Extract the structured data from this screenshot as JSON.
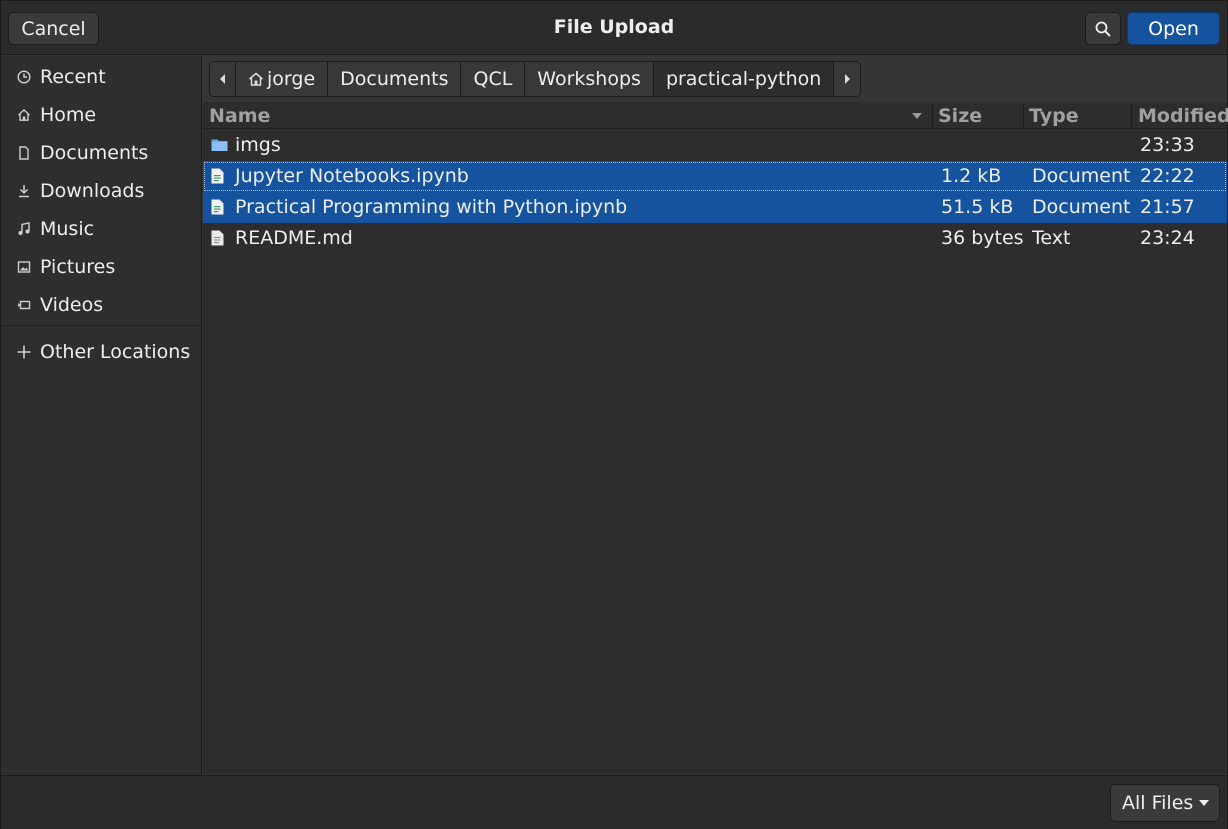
{
  "header": {
    "cancel_label": "Cancel",
    "title": "File Upload",
    "search_icon": "search-icon",
    "open_label": "Open"
  },
  "sidebar": {
    "items": [
      {
        "label": "Recent",
        "icon": "clock-icon"
      },
      {
        "label": "Home",
        "icon": "home-icon"
      },
      {
        "label": "Documents",
        "icon": "document-icon"
      },
      {
        "label": "Downloads",
        "icon": "download-icon"
      },
      {
        "label": "Music",
        "icon": "music-icon"
      },
      {
        "label": "Pictures",
        "icon": "picture-icon"
      },
      {
        "label": "Videos",
        "icon": "video-icon"
      }
    ],
    "other_locations": {
      "label": "Other Locations",
      "icon": "plus-icon"
    }
  },
  "pathbar": {
    "segments": [
      "jorge",
      "Documents",
      "QCL",
      "Workshops",
      "practical-python"
    ],
    "current": "practical-python"
  },
  "columns": {
    "name": "Name",
    "size": "Size",
    "type": "Type",
    "modified": "Modified",
    "sort": "descending"
  },
  "files": [
    {
      "name": "imgs",
      "size": "",
      "type": "",
      "modified": "23:33",
      "kind": "folder",
      "selected": false
    },
    {
      "name": "Jupyter Notebooks.ipynb",
      "size": "1.2 kB",
      "type": "Document",
      "modified": "22:22",
      "kind": "document",
      "selected": true
    },
    {
      "name": "Practical Programming with Python.ipynb",
      "size": "51.5 kB",
      "type": "Document",
      "modified": "21:57",
      "kind": "document",
      "selected": true
    },
    {
      "name": "README.md",
      "size": "36 bytes",
      "type": "Text",
      "modified": "23:24",
      "kind": "text",
      "selected": false
    }
  ],
  "footer": {
    "filter_label": "All Files"
  },
  "colors": {
    "accent": "#15539e",
    "background": "#353535",
    "sidebar": "#2e2e2e"
  }
}
